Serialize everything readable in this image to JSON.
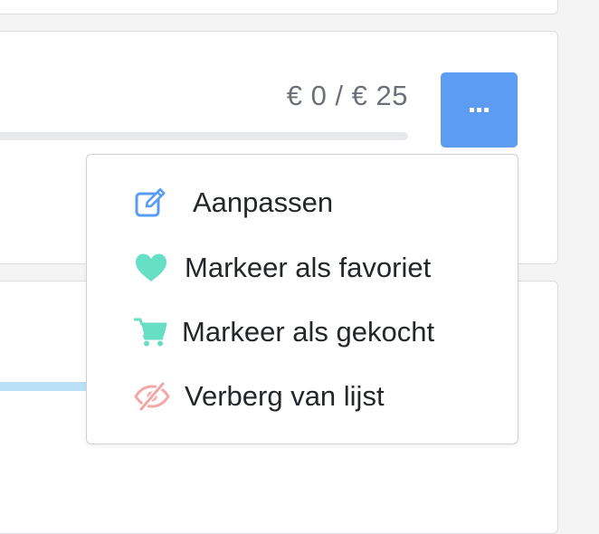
{
  "budget": {
    "amount_text": "€ 0 / € 25",
    "progress_fraction": 0
  },
  "more_button": {
    "icon": "ellipsis-icon"
  },
  "menu": {
    "items": [
      {
        "label": "Aanpassen",
        "icon": "edit-icon",
        "color": "#5a9cf2"
      },
      {
        "label": "Markeer als favoriet",
        "icon": "heart-icon",
        "color": "#66dfc4"
      },
      {
        "label": "Markeer als gekocht",
        "icon": "cart-icon",
        "color": "#66dfc4"
      },
      {
        "label": "Verberg van lijst",
        "icon": "eye-slash-icon",
        "color": "#f3a6a6"
      }
    ]
  },
  "colors": {
    "accent_blue": "#5c9cf2",
    "light_blue": "#b9e0f7",
    "track_gray": "#e8e9ec"
  }
}
